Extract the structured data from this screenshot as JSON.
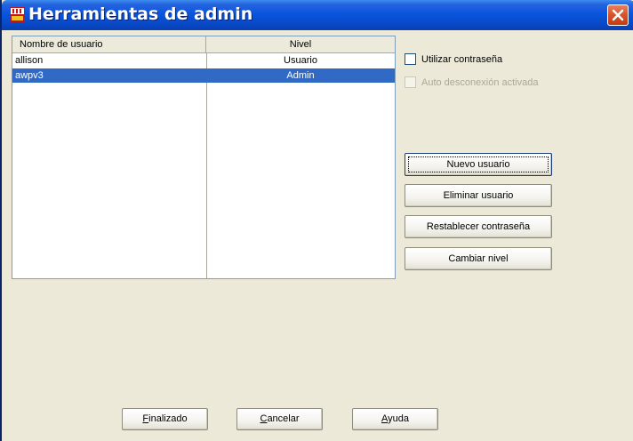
{
  "window": {
    "title": "Herramientas de admin",
    "icon": "app-icon",
    "close_icon": "close-icon"
  },
  "users_table": {
    "columns": [
      "Nombre de usuario",
      "Nivel"
    ],
    "rows": [
      {
        "name": "allison",
        "level": "Usuario",
        "selected": false
      },
      {
        "name": "awpv3",
        "level": "Admin",
        "selected": true
      }
    ],
    "selection_color": "#316ac5"
  },
  "options": {
    "use_password": {
      "label": "Utilizar contraseña",
      "checked": false,
      "enabled": true
    },
    "auto_logoff": {
      "label": "Auto desconexión activada",
      "checked": false,
      "enabled": false
    }
  },
  "actions": {
    "new_user": "Nuevo usuario",
    "delete_user": "Eliminar usuario",
    "reset_password": "Restablecer contraseña",
    "change_level": "Cambiar nivel"
  },
  "footer": {
    "done": {
      "accel": "F",
      "rest": "inalizado"
    },
    "cancel": {
      "accel": "C",
      "rest": "ancelar"
    },
    "help": {
      "accel": "A",
      "rest": "yuda"
    }
  }
}
